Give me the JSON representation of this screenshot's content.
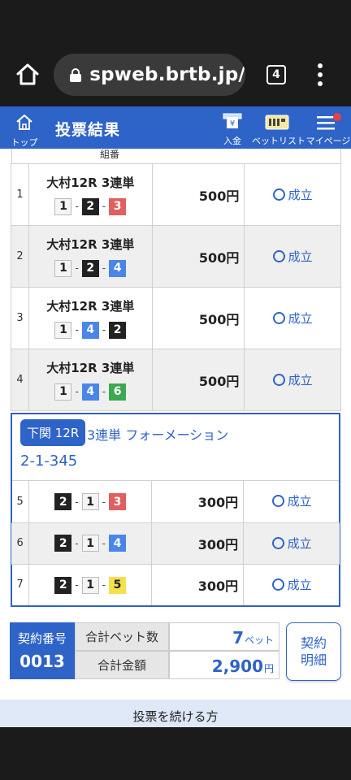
{
  "browser": {
    "url": "spweb.brtb.jp/",
    "tab_count": "4"
  },
  "header": {
    "home_label": "トップ",
    "title": "投票結果",
    "deposit_label": "入金",
    "betlist_label": "ベットリスト",
    "mypage_label": "マイページ"
  },
  "table": {
    "column_header": "組番",
    "rows": [
      {
        "num": "1",
        "race": "大村12R 3連単",
        "combo": [
          "1",
          "2",
          "3"
        ],
        "amount": "500円",
        "status": "成立"
      },
      {
        "num": "2",
        "race": "大村12R 3連単",
        "combo": [
          "1",
          "2",
          "4"
        ],
        "amount": "500円",
        "status": "成立"
      },
      {
        "num": "3",
        "race": "大村12R 3連単",
        "combo": [
          "1",
          "4",
          "2"
        ],
        "amount": "500円",
        "status": "成立"
      },
      {
        "num": "4",
        "race": "大村12R 3連単",
        "combo": [
          "1",
          "4",
          "6"
        ],
        "amount": "500円",
        "status": "成立"
      }
    ]
  },
  "formation": {
    "venue": "下関 12R",
    "type": "3連単 フォーメーション",
    "combination": "2-1-345",
    "rows": [
      {
        "num": "5",
        "combo": [
          "2",
          "1",
          "3"
        ],
        "amount": "300円",
        "status": "成立"
      },
      {
        "num": "6",
        "combo": [
          "2",
          "1",
          "4"
        ],
        "amount": "300円",
        "status": "成立"
      },
      {
        "num": "7",
        "combo": [
          "2",
          "1",
          "5"
        ],
        "amount": "300円",
        "status": "成立"
      }
    ]
  },
  "summary": {
    "contract_label": "契約番号",
    "contract_number": "0013",
    "total_bets_label": "合計ベット数",
    "total_bets_value": "7",
    "total_bets_unit": "ベット",
    "total_amount_label": "合計金額",
    "total_amount_value": "2,900",
    "total_amount_unit": "円",
    "detail_button_line1": "契約",
    "detail_button_line2": "明細"
  },
  "footer": {
    "continue_text": "投票を続ける方"
  },
  "colors": {
    "brand_blue": "#2e63c8",
    "boat_1": "#f4f4f4",
    "boat_2": "#222222",
    "boat_3": "#e05f5f",
    "boat_4": "#4a86e8",
    "boat_5": "#f6e14b",
    "boat_6": "#3ca850"
  }
}
